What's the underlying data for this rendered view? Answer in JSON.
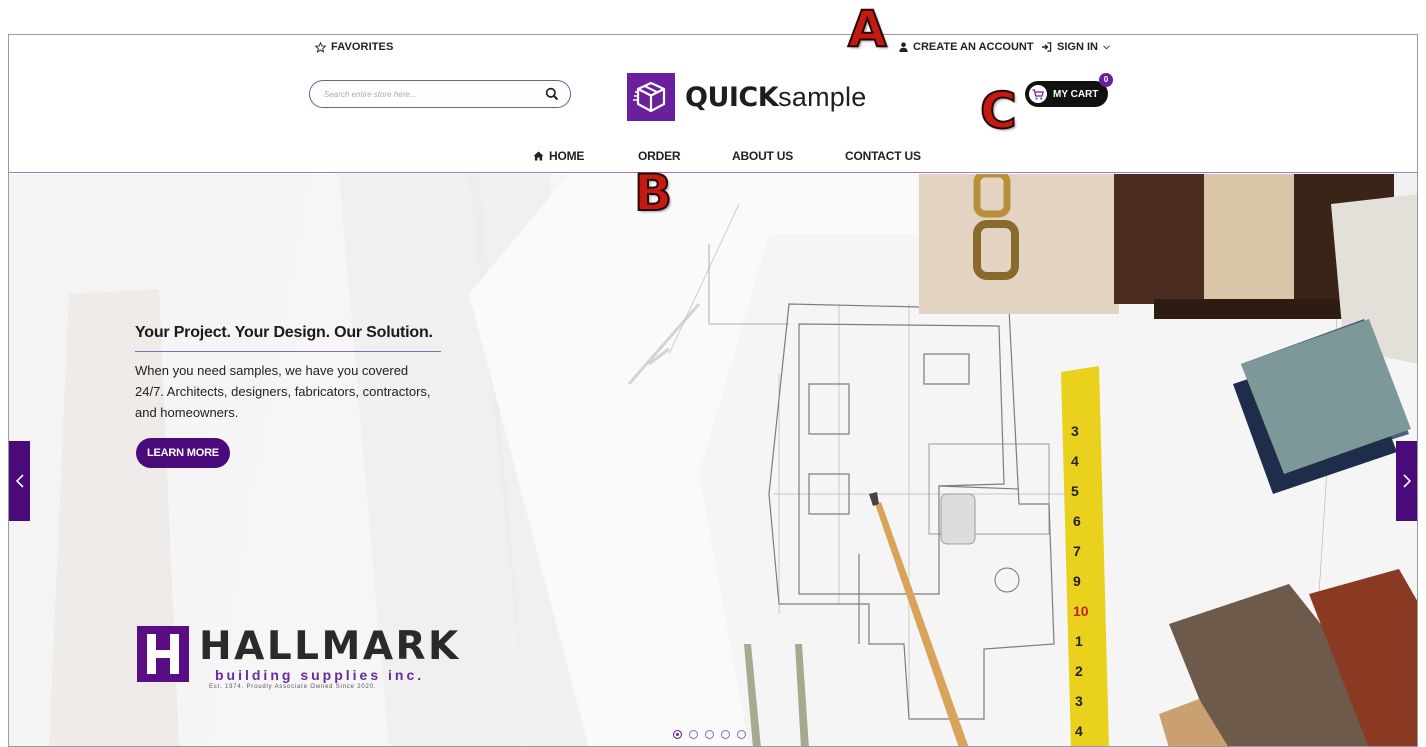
{
  "header": {
    "favorites_label": "FAVORITES",
    "create_account_label": "CREATE AN ACCOUNT",
    "sign_in_label": "SIGN IN",
    "search_placeholder": "Search entire store here...",
    "logo_bold": "QUICK",
    "logo_light": "sample",
    "cart_label": "MY CART",
    "cart_count": "0"
  },
  "nav": {
    "items": [
      {
        "label": "HOME",
        "icon": "home-icon"
      },
      {
        "label": "ORDER"
      },
      {
        "label": "ABOUT US"
      },
      {
        "label": "CONTACT US"
      }
    ]
  },
  "hero": {
    "title": "Your Project. Your Design. Our Solution.",
    "body": "When you need samples, we have you covered 24/7. Architects, designers, fabricators, contractors, and homeowners.",
    "cta_label": "LEARN MORE",
    "brand_name": "HALLMARK",
    "brand_sub": "building supplies inc.",
    "brand_est": "Est. 1974. Proudly Associate Owned Since 2020.",
    "slide_count": 5,
    "active_slide": 0
  },
  "callouts": {
    "a": "A",
    "b": "B",
    "c": "C"
  },
  "colors": {
    "brand_purple": "#6a1f9c",
    "dark_purple": "#4a0a7a",
    "callout_red": "#c31a12"
  }
}
